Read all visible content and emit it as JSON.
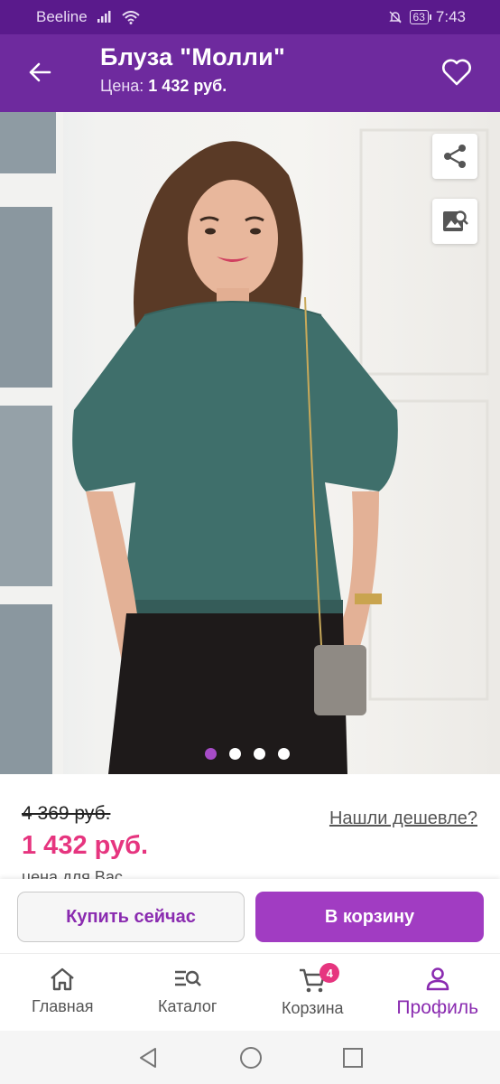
{
  "status_bar": {
    "carrier": "Beeline",
    "battery": "63",
    "time": "7:43"
  },
  "header": {
    "title": "Блуза \"Молли\"",
    "price_label": "Цена:",
    "price_value": "1 432 руб."
  },
  "gallery": {
    "image_description": "product-photo",
    "dots_total": 4,
    "active_index": 0
  },
  "pricing": {
    "old_price": "4 369 руб.",
    "new_price": "1 432 руб.",
    "caption": "цена для Вас",
    "cheaper_link": "Нашли дешевле?"
  },
  "actions": {
    "buy_now": "Купить сейчас",
    "add_to_cart": "В корзину"
  },
  "bottom_nav": {
    "items": [
      {
        "label": "Главная",
        "icon": "home-icon"
      },
      {
        "label": "Каталог",
        "icon": "catalog-search-icon"
      },
      {
        "label": "Корзина",
        "icon": "cart-icon",
        "badge": "4"
      },
      {
        "label": "Профиль",
        "icon": "profile-icon",
        "active": true
      }
    ]
  },
  "colors": {
    "status_bar": "#5a1a8c",
    "app_bar": "#6e2a9e",
    "accent": "#a13cc2",
    "price": "#e6357f"
  }
}
